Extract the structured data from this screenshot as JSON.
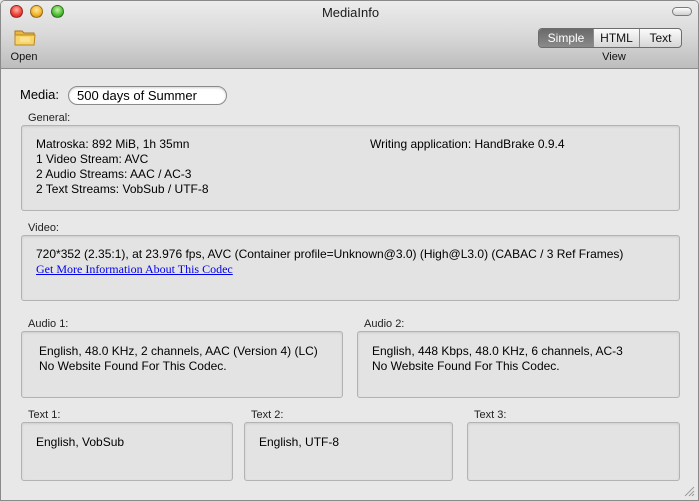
{
  "window": {
    "title": "MediaInfo"
  },
  "toolbar": {
    "open_label": "Open",
    "view_label": "View",
    "view_modes": [
      {
        "label": "Simple",
        "active": true
      },
      {
        "label": "HTML",
        "active": false
      },
      {
        "label": "Text",
        "active": false
      }
    ]
  },
  "media": {
    "label": "Media:",
    "value": "500 days of Summer"
  },
  "general": {
    "label": "General:",
    "left_lines": [
      "Matroska: 892 MiB, 1h 35mn",
      "1 Video Stream: AVC",
      "2 Audio Streams: AAC / AC-3",
      "2 Text Streams: VobSub / UTF-8"
    ],
    "writing_application": "Writing application: HandBrake 0.9.4"
  },
  "video": {
    "label": "Video:",
    "line": "720*352 (2.35:1), at 23.976 fps, AVC (Container profile=Unknown@3.0) (High@L3.0) (CABAC / 3 Ref Frames)",
    "link": "Get More Information About This Codec"
  },
  "audio1": {
    "label": "Audio 1:",
    "lines": [
      "English, 48.0 KHz, 2 channels, AAC (Version 4) (LC)",
      "No Website Found For This Codec."
    ]
  },
  "audio2": {
    "label": "Audio 2:",
    "lines": [
      "English, 448 Kbps, 48.0 KHz, 6 channels, AC-3",
      "No Website Found For This Codec."
    ]
  },
  "text1": {
    "label": "Text 1:",
    "value": "English, VobSub"
  },
  "text2": {
    "label": "Text 2:",
    "value": "English, UTF-8"
  },
  "text3": {
    "label": "Text 3:",
    "value": ""
  },
  "colors": {
    "link": "#0000ee",
    "segment_active": "#7a7a7a",
    "close": "#f0433a",
    "minimize": "#f5b630",
    "zoom": "#52c23a"
  }
}
